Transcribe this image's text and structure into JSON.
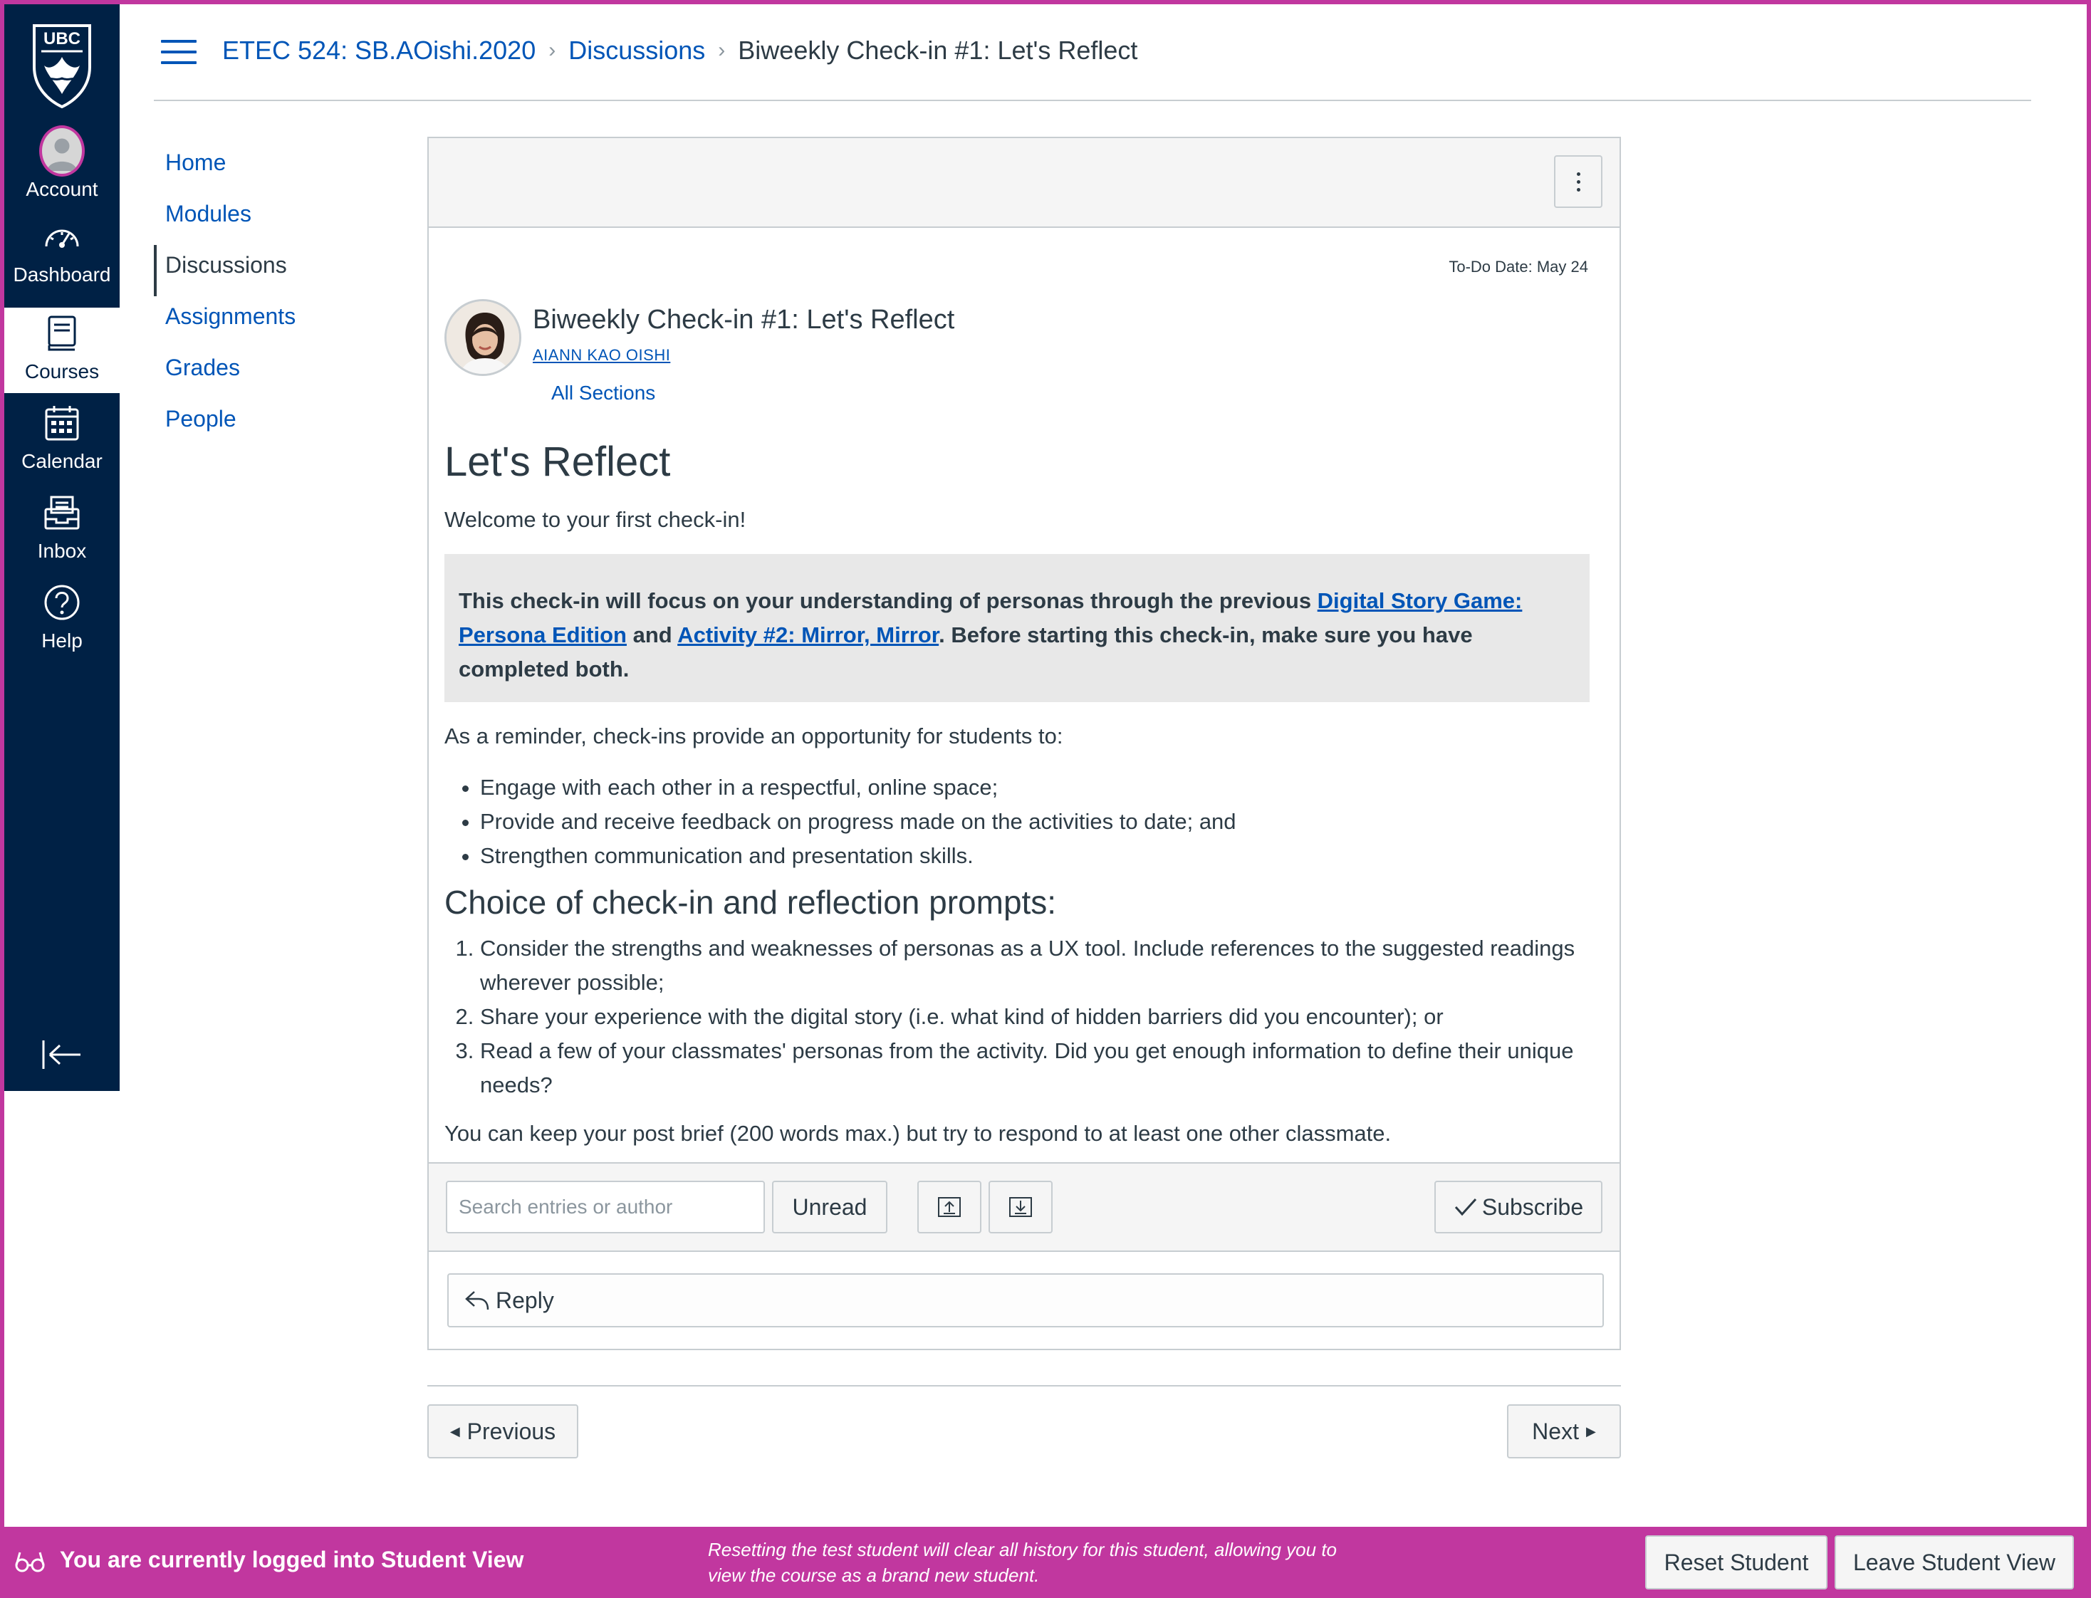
{
  "global_nav": {
    "logo_text": "UBC",
    "items": [
      {
        "label": "Account",
        "icon": "avatar"
      },
      {
        "label": "Dashboard",
        "icon": "dashboard-icon"
      },
      {
        "label": "Courses",
        "icon": "courses-icon"
      },
      {
        "label": "Calendar",
        "icon": "calendar-icon"
      },
      {
        "label": "Inbox",
        "icon": "inbox-icon"
      },
      {
        "label": "Help",
        "icon": "help-icon"
      }
    ]
  },
  "breadcrumb": {
    "course": "ETEC 524: SB.AOishi.2020",
    "section": "Discussions",
    "current": "Biweekly Check-in #1: Let's Reflect"
  },
  "course_nav": {
    "items": [
      "Home",
      "Modules",
      "Discussions",
      "Assignments",
      "Grades",
      "People"
    ],
    "active": "Discussions"
  },
  "discussion": {
    "todo_date": "To-Do Date: May 24",
    "title": "Biweekly Check-in #1: Let's Reflect",
    "author": "AIANN KAO OISHI",
    "sections": "All Sections",
    "heading": "Let's Reflect",
    "welcome": "Welcome to your first check-in!",
    "callout": {
      "part1": "This check-in will focus on your understanding of personas through the previous ",
      "link1": "Digital Story Game: Persona Edition",
      "part2": " and ",
      "link2": "Activity #2: Mirror, Mirror",
      "part3": ". Before starting this check-in, make sure you have completed both."
    },
    "reminder": "As a reminder, check-ins provide an opportunity for students to:",
    "bullets": [
      "Engage with each other in a respectful, online space;",
      "Provide and receive feedback on progress made on the activities to date; and",
      "Strengthen communication and presentation skills."
    ],
    "prompts_heading": "Choice of check-in and reflection prompts:",
    "prompts": [
      "Consider the strengths and weaknesses of personas as a UX tool. Include references to the suggested readings wherever possible;",
      "Share your experience with the digital story (i.e. what kind of hidden barriers did you encounter); or",
      "Read a few of your classmates' personas from the activity. Did you get enough information to define their unique needs?"
    ],
    "closing": "You can keep your post brief (200 words max.) but try to respond to at least one other classmate."
  },
  "toolbar": {
    "search_placeholder": "Search entries or author",
    "unread_label": "Unread",
    "subscribe_label": "Subscribe"
  },
  "reply": {
    "label": "Reply"
  },
  "pagination": {
    "previous": "Previous",
    "next": "Next"
  },
  "student_view": {
    "message": "You are currently logged into Student View",
    "note": "Resetting the test student will clear all history for this student, allowing you to view the course as a brand new student.",
    "reset_label": "Reset Student",
    "leave_label": "Leave Student View"
  },
  "colors": {
    "nav_bg": "#002145",
    "accent": "#c1379f",
    "link": "#0055b7"
  }
}
